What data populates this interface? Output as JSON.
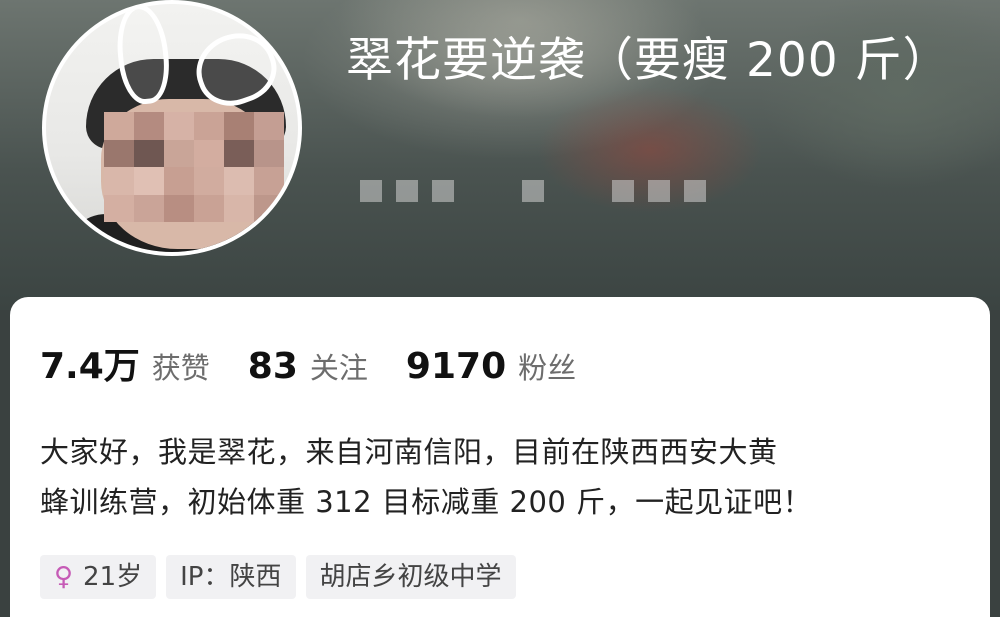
{
  "profile": {
    "name": "翠花要逆袭（要瘦 200 斤）",
    "stats": [
      {
        "value": "7.4万",
        "label": "获赞"
      },
      {
        "value": "83",
        "label": "关注"
      },
      {
        "value": "9170",
        "label": "粉丝"
      }
    ],
    "bio_line1": "大家好，我是翠花，来自河南信阳，目前在陕西西安大黄",
    "bio_line2": "蜂训练营，初始体重 312 目标减重 200 斤，一起见证吧！",
    "tags": {
      "gender_icon": "female-icon",
      "gender_symbol": "♀",
      "age": "21岁",
      "ip": "IP：陕西",
      "school": "胡店乡初级中学"
    }
  },
  "colors": {
    "card_bg": "#ffffff",
    "tag_bg": "#f1f1f3",
    "gender_accent": "#c65bb6",
    "stat_label": "#6d6d6d"
  }
}
